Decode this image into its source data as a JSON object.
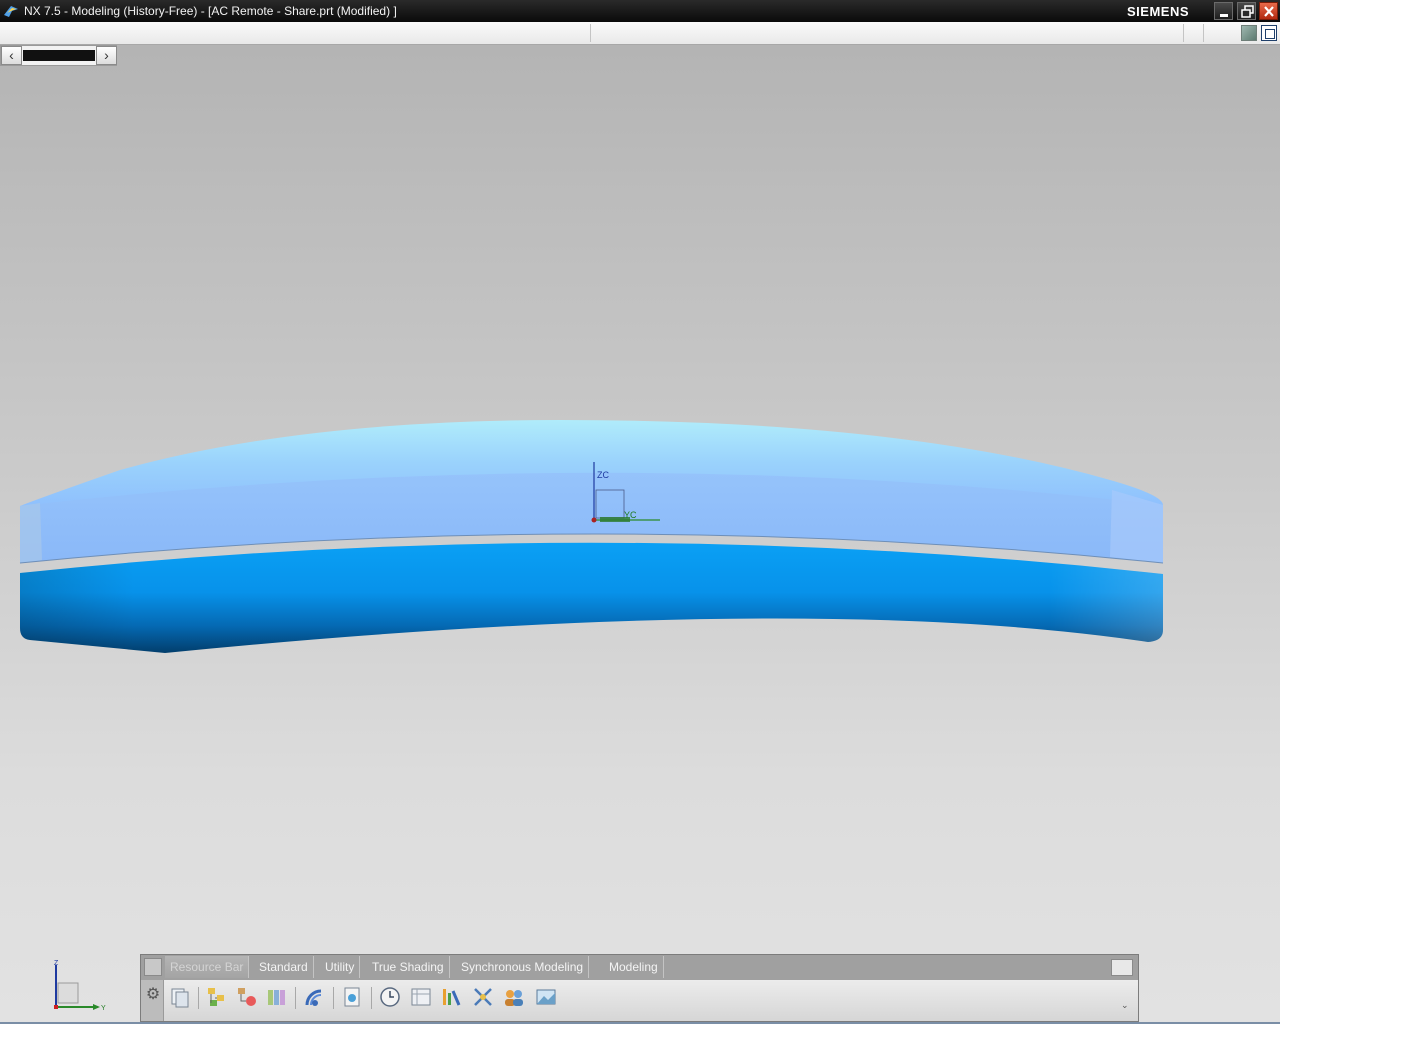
{
  "window": {
    "title": "NX 7.5 - Modeling (History-Free) - [AC Remote - Share.prt (Modified) ]",
    "brand": "SIEMENS",
    "controls": [
      "minimize-icon",
      "restore-icon",
      "close-icon"
    ]
  },
  "viewport": {
    "wcs_labels": {
      "z": "ZC",
      "y": "YC"
    },
    "triad_labels": {
      "z": "Z",
      "y": "Y"
    },
    "colors": {
      "background_top": "#b4b4b4",
      "background_bottom": "#e2e2e2",
      "top_part": "#92c2fd",
      "top_part_highlight": "#b0ecfb",
      "bottom_part": "#0797ef",
      "bottom_part_shadow": "#034070"
    }
  },
  "toolbar_panel": {
    "tabs": [
      {
        "label": "Resource Bar",
        "active": true
      },
      {
        "label": "Standard",
        "active": false
      },
      {
        "label": "Utility",
        "active": false
      },
      {
        "label": "True Shading",
        "active": false
      },
      {
        "label": "Synchronous Modeling",
        "active": false
      },
      {
        "label": "Modeling",
        "active": false
      }
    ],
    "icons": [
      "clipboard-icon",
      "assembly-navigator-icon",
      "constraint-navigator-icon",
      "part-navigator-icon",
      "web-browser-icon",
      "history-icon",
      "clock-icon",
      "reuse-library-icon",
      "hd3d-tools-icon",
      "process-studio-icon",
      "roles-icon",
      "system-visualization-icon"
    ]
  }
}
